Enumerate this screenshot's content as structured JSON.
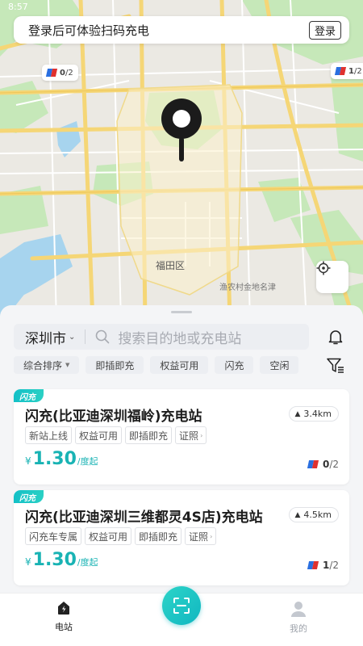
{
  "status_bar": {
    "time": "8:57"
  },
  "login_banner": {
    "text": "登录后可体验扫码充电",
    "button": "登录"
  },
  "map": {
    "markers": [
      {
        "count": "0",
        "total": "2"
      },
      {
        "count": "1",
        "total": "2"
      }
    ],
    "district_label": "福田区",
    "road_label": "渔农村金地名津"
  },
  "search": {
    "city": "深圳市",
    "placeholder": "搜索目的地或充电站"
  },
  "filters": [
    "综合排序",
    "即插即充",
    "权益可用",
    "闪充",
    "空闲"
  ],
  "stations": [
    {
      "badge": "闪充",
      "name": "闪充(比亚迪深圳福岭)充电站",
      "distance": "3.4km",
      "tags": [
        "新站上线",
        "权益可用",
        "即插即充",
        "证照"
      ],
      "currency": "¥",
      "price": "1.30",
      "unit": "/度起",
      "available": "0",
      "total": "/2"
    },
    {
      "badge": "闪充",
      "name": "闪充(比亚迪深圳三维都灵4S店)充电站",
      "distance": "4.5km",
      "tags": [
        "闪充车专属",
        "权益可用",
        "即插即充",
        "证照"
      ],
      "currency": "¥",
      "price": "1.30",
      "unit": "/度起",
      "available": "1",
      "total": "/2"
    }
  ],
  "tabbar": {
    "stations": "电站",
    "mine": "我的"
  },
  "colors": {
    "accent": "#19b3b4",
    "park": "#bfe6b4",
    "water": "#a9d6ef",
    "road": "#f6d77a"
  }
}
